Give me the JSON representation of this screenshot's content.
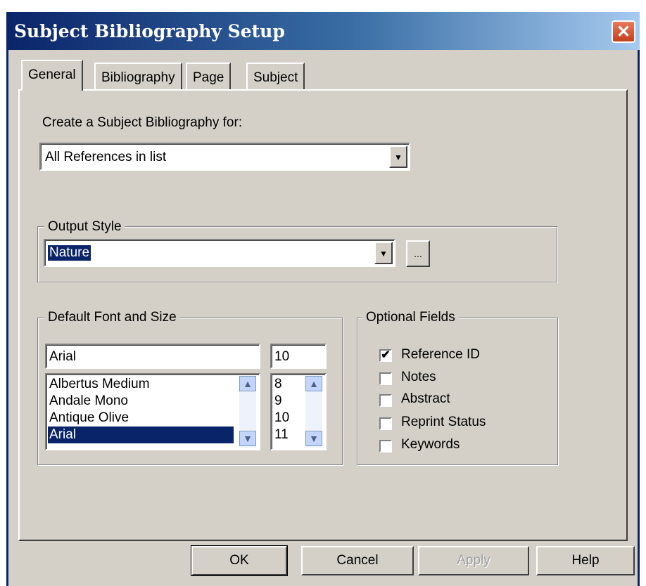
{
  "window": {
    "title": "Subject Bibliography Setup",
    "close_glyph": "✕"
  },
  "tabs": [
    {
      "label": "General",
      "active": true
    },
    {
      "label": "Bibliography"
    },
    {
      "label": "Page"
    },
    {
      "label": "Subject"
    }
  ],
  "general": {
    "create_label": "Create a Subject Bibliography for:",
    "create_value": "All References in list",
    "output_style": {
      "legend": "Output Style",
      "value": "Nature",
      "browse_label": "..."
    },
    "font": {
      "legend": "Default Font and Size",
      "font_value": "Arial",
      "size_value": "10",
      "fonts": [
        "Albertus Medium",
        "Andale Mono",
        "Antique Olive",
        "Arial"
      ],
      "selected_font": "Arial",
      "sizes": [
        "8",
        "9",
        "10",
        "11"
      ]
    },
    "optional_fields": {
      "legend": "Optional Fields",
      "items": [
        {
          "label": "Reference ID",
          "checked": true
        },
        {
          "label": "Notes",
          "checked": false
        },
        {
          "label": "Abstract",
          "checked": false
        },
        {
          "label": "Reprint Status",
          "checked": false
        },
        {
          "label": "Keywords",
          "checked": false
        }
      ]
    }
  },
  "buttons": {
    "ok": "OK",
    "cancel": "Cancel",
    "apply": "Apply",
    "help": "Help"
  },
  "icons": {
    "dropdown": "dropdown-arrow-icon",
    "scroll_up": "scroll-up-icon",
    "scroll_down": "scroll-down-icon",
    "check": "check-icon"
  }
}
